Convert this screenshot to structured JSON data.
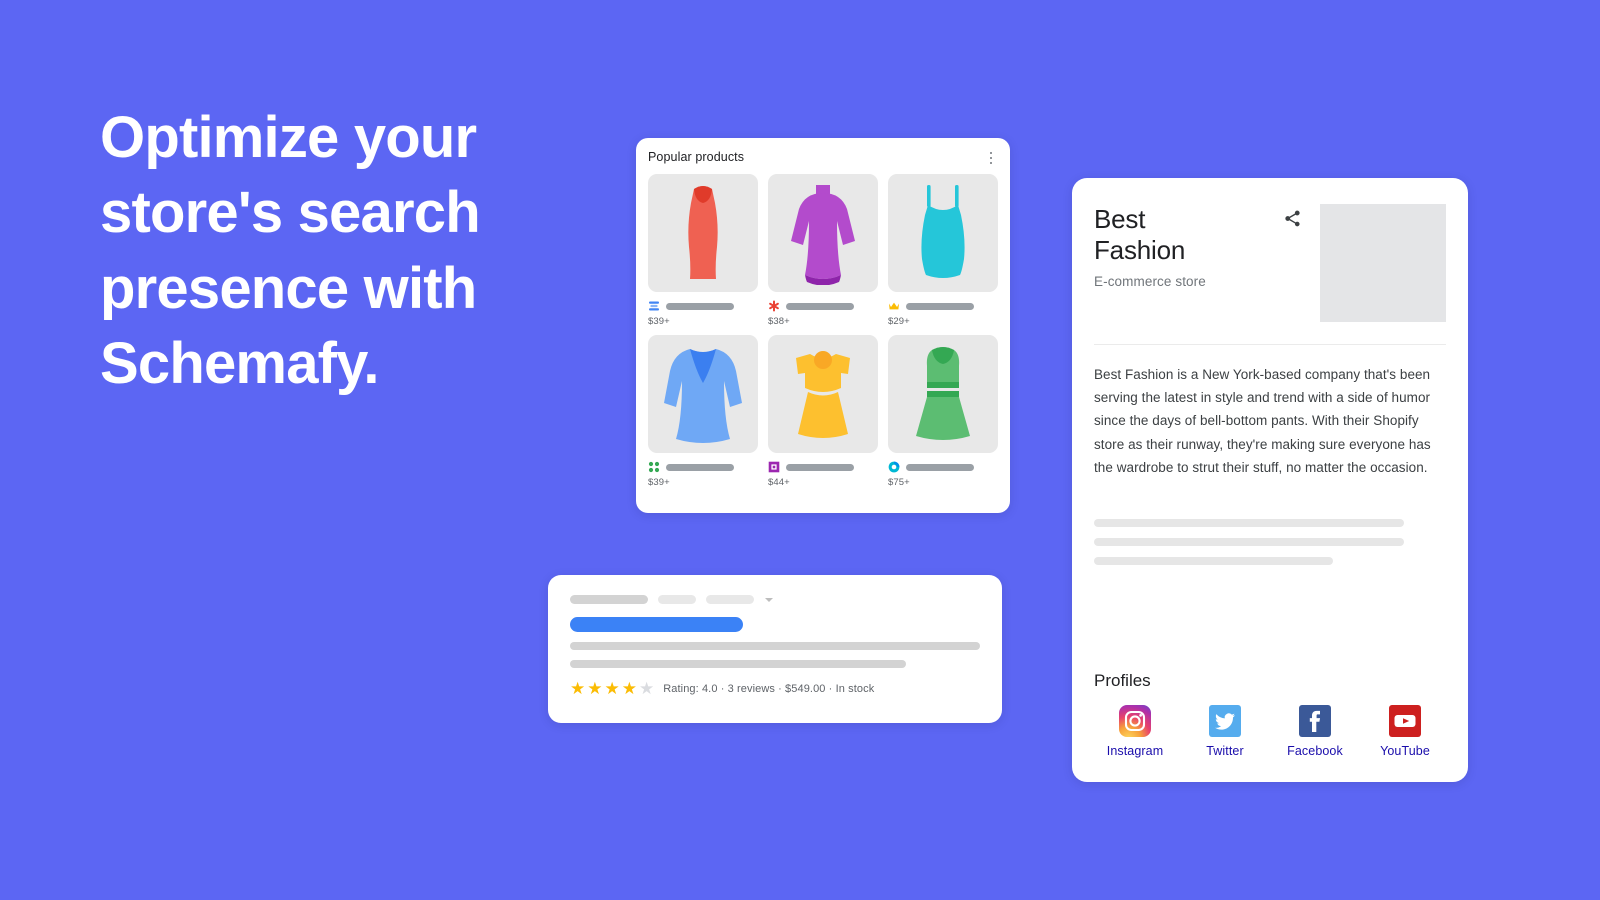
{
  "theme": {
    "background": "#5c66f3",
    "card_background": "#ffffff",
    "link_color": "#1a0dab",
    "star_color": "#fbbc04",
    "result_title_color": "#3b82f6"
  },
  "hero": {
    "title": "Optimize your store's search presence with Schemafy."
  },
  "products_card": {
    "title": "Popular products",
    "menu_icon": "kebab-menu-icon",
    "items": [
      {
        "name": "red-sheath-dress",
        "price": "$39+",
        "color": "#ef6152",
        "favicon": "blue-lines-favicon"
      },
      {
        "name": "purple-turtleneck-dress",
        "price": "$38+",
        "color": "#b34bcc",
        "favicon": "red-asterisk-favicon"
      },
      {
        "name": "teal-camisole-dress",
        "price": "$29+",
        "color": "#25c6d9",
        "favicon": "gold-crown-favicon"
      },
      {
        "name": "blue-long-sleeve-dress",
        "price": "$39+",
        "color": "#6fa8f5",
        "favicon": "green-dots-favicon"
      },
      {
        "name": "yellow-peplum-dress",
        "price": "$44+",
        "color": "#fdc02f",
        "favicon": "purple-square-favicon"
      },
      {
        "name": "green-striped-dress",
        "price": "$75+",
        "color": "#5cbd72",
        "favicon": "cyan-ring-favicon"
      }
    ]
  },
  "result_card": {
    "breadcrumb_placeholder_count": 3,
    "dropdown_icon": "chevron-down-icon",
    "rating_stars_filled": 4,
    "rating_stars_total": 5,
    "rating_text": "Rating: 4.0  ·  3 reviews  ·  $549.00  ·  In stock"
  },
  "knowledge_panel": {
    "title": "Best Fashion",
    "subtitle": "E-commerce store",
    "share_icon": "share-icon",
    "image_placeholder": "store-image-placeholder",
    "description": "Best Fashion is a New York-based company that's been serving the latest in style and trend with a side of humor since the days of bell-bottom pants. With their Shopify store as their runway, they're making sure everyone has the wardrobe to strut their stuff, no matter the occasion.",
    "profiles_title": "Profiles",
    "profiles": [
      {
        "label": "Instagram",
        "icon": "instagram-icon"
      },
      {
        "label": "Twitter",
        "icon": "twitter-icon"
      },
      {
        "label": "Facebook",
        "icon": "facebook-icon"
      },
      {
        "label": "YouTube",
        "icon": "youtube-icon"
      }
    ]
  }
}
